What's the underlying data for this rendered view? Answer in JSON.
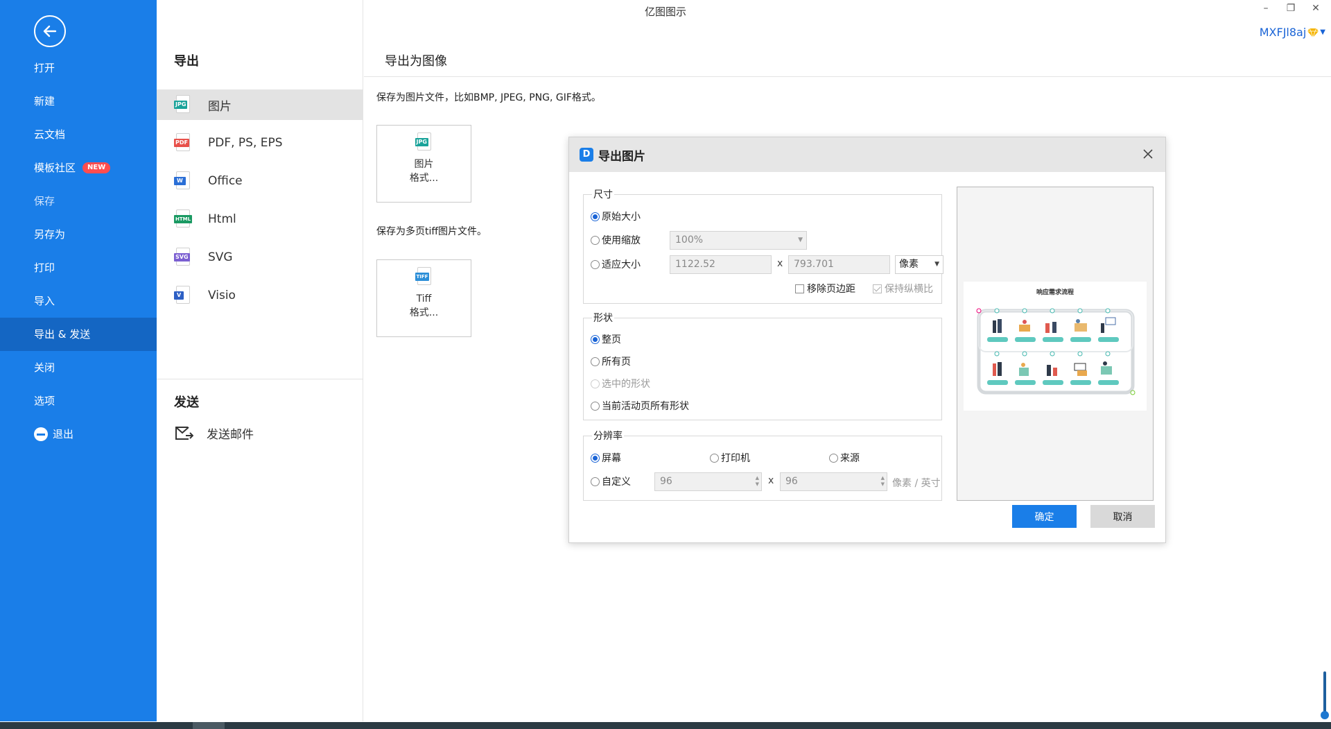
{
  "app": {
    "title": "亿图图示",
    "window_controls": {
      "minimize": "–",
      "restore": "❐",
      "close": "✕"
    }
  },
  "user": {
    "name": "MXFJl8aj"
  },
  "sidebar": {
    "items": [
      {
        "label": "打开"
      },
      {
        "label": "新建"
      },
      {
        "label": "云文档"
      },
      {
        "label": "模板社区",
        "badge": "NEW"
      },
      {
        "label": "保存"
      },
      {
        "label": "另存为"
      },
      {
        "label": "打印"
      },
      {
        "label": "导入"
      },
      {
        "label": "导出 & 发送"
      },
      {
        "label": "关闭"
      },
      {
        "label": "选项"
      },
      {
        "label": "退出"
      }
    ]
  },
  "export_panel": {
    "title": "导出",
    "items": [
      {
        "label": "图片",
        "tag": "JPG"
      },
      {
        "label": "PDF, PS, EPS",
        "tag": "PDF"
      },
      {
        "label": "Office",
        "tag": "W"
      },
      {
        "label": "Html",
        "tag": "HTML"
      },
      {
        "label": "SVG",
        "tag": "SVG"
      },
      {
        "label": "Visio",
        "tag": "V"
      }
    ],
    "send_title": "发送",
    "send_items": [
      {
        "label": "发送邮件"
      }
    ]
  },
  "content": {
    "title": "导出为图像",
    "image_desc": "保存为图片文件，比如BMP, JPEG, PNG, GIF格式。",
    "image_button": {
      "tag": "JPG",
      "line1": "图片",
      "line2": "格式..."
    },
    "tiff_desc": "保存为多页tiff图片文件。",
    "tiff_button": {
      "tag": "TIFF",
      "line1": "Tiff",
      "line2": "格式..."
    }
  },
  "dialog": {
    "title": "导出图片",
    "size_group": {
      "legend": "尺寸",
      "original": "原始大小",
      "use_scale": "使用缩放",
      "scale_value": "100%",
      "fit_size": "适应大小",
      "width": "1122.52",
      "times": "x",
      "height": "793.701",
      "unit": "像素",
      "remove_margin": "移除页边距",
      "keep_ratio": "保持纵横比"
    },
    "shape_group": {
      "legend": "形状",
      "whole_page": "整页",
      "all_pages": "所有页",
      "selected_shapes": "选中的形状",
      "current_page_shapes": "当前活动页所有形状"
    },
    "resolution_group": {
      "legend": "分辨率",
      "screen": "屏幕",
      "printer": "打印机",
      "source": "来源",
      "custom": "自定义",
      "dpi_x": "96",
      "times": "x",
      "dpi_y": "96",
      "unit": "像素 / 英寸"
    },
    "preview": {
      "diagram_title": "响应需求流程"
    },
    "ok": "确定",
    "cancel": "取消"
  },
  "colors": {
    "accent": "#1a7ee8",
    "sidebar_active": "#1466c3",
    "badge": "#ff4d4f"
  }
}
